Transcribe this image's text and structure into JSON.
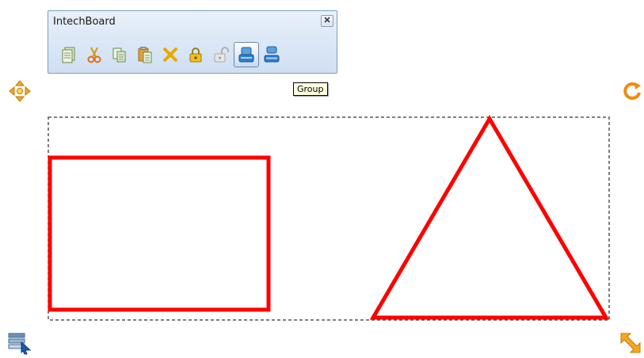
{
  "toolbar": {
    "title": "IntechBoard",
    "buttons": [
      {
        "icon": "new-page-icon"
      },
      {
        "icon": "cut-icon"
      },
      {
        "icon": "copy-icon"
      },
      {
        "icon": "paste-icon"
      },
      {
        "icon": "delete-icon"
      },
      {
        "icon": "lock-icon"
      },
      {
        "icon": "unlock-icon"
      },
      {
        "icon": "group-icon",
        "active": true
      },
      {
        "icon": "ungroup-icon"
      }
    ]
  },
  "tooltip": {
    "text": "Group"
  },
  "colors": {
    "shape_stroke": "#ff0000",
    "selection": "#555555",
    "handle_orange": "#f5a623"
  }
}
